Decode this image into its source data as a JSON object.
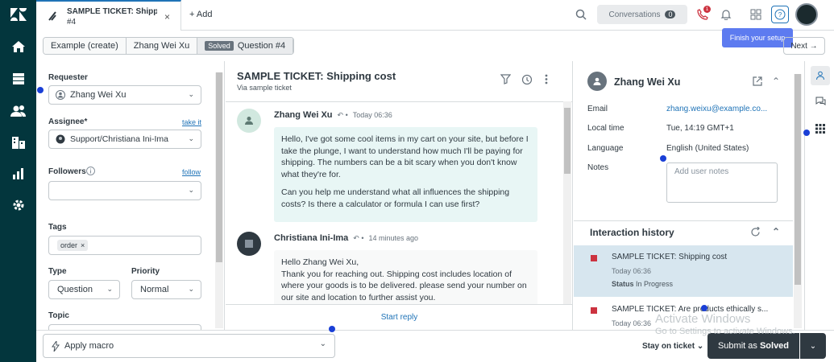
{
  "tab": {
    "title": "SAMPLE TICKET: Shipping cost",
    "number": "#4",
    "close": "×"
  },
  "header": {
    "add_label": "+ Add",
    "conversations_label": "Conversations",
    "conversations_count": "0",
    "phone_badge": "1",
    "tooltip": "Finish your setup"
  },
  "breadcrumbs": {
    "item1": "Example (create)",
    "item2": "Zhang Wei Xu",
    "status": "Solved",
    "item3": "Question #4",
    "next": "Next →"
  },
  "ticket_fields": {
    "requester_label": "Requester",
    "requester_value": "Zhang Wei Xu",
    "assignee_label": "Assignee*",
    "take_it": "take it",
    "assignee_value": "Support/Christiana Ini-Ima",
    "followers_label": "Followers",
    "follow": "follow",
    "tags_label": "Tags",
    "tag": "order",
    "type_label": "Type",
    "type_value": "Question",
    "priority_label": "Priority",
    "priority_value": "Normal",
    "topic_label": "Topic"
  },
  "conversation": {
    "title": "SAMPLE TICKET: Shipping cost",
    "subtitle": "Via sample ticket",
    "messages": [
      {
        "author": "Zhang Wei Xu",
        "time": "Today 06:36",
        "p1": "Hello, I've got some cool items in my cart on your site, but before I take the plunge, I want to understand how much I'll be paying for shipping. The numbers can be a bit scary when you don't know what they're for.",
        "p2": "Can you help me understand what all influences the shipping costs? Is there a calculator or formula I can use first?"
      },
      {
        "author": "Christiana Ini-Ima",
        "time": "14 minutes ago",
        "p1": "Hello Zhang Wei Xu,",
        "p2": "Thank you for reaching out. Shipping cost includes location of where your goods is to be delivered. please send your number on our site and location to further assist you."
      }
    ],
    "start_reply": "Start reply"
  },
  "user_panel": {
    "name": "Zhang Wei Xu",
    "email_label": "Email",
    "email": "zhang.weixu@example.co...",
    "local_time_label": "Local time",
    "local_time": "Tue, 14:19 GMT+1",
    "language_label": "Language",
    "language": "English (United States)",
    "notes_label": "Notes",
    "notes_placeholder": "Add user notes"
  },
  "interaction_history": {
    "title": "Interaction history",
    "items": [
      {
        "title": "SAMPLE TICKET: Shipping cost",
        "time": "Today 06:36",
        "status_label": "Status",
        "status": "In Progress"
      },
      {
        "title": "SAMPLE TICKET: Are products ethically s...",
        "time": "Today 06:36"
      }
    ]
  },
  "footer": {
    "apply_macro": "Apply macro",
    "stay_on_ticket": "Stay on ticket",
    "submit_prefix": "Submit as",
    "submit_status": "Solved"
  },
  "watermark": {
    "line1": "Activate Windows",
    "line2": "Go to Settings to activate Windows."
  },
  "colors": {
    "nav_bg": "#03363d",
    "accent": "#1f73b7",
    "submit_bg": "#2f3941",
    "tooltip_bg": "#5d7bf0",
    "history_active": "#d7e6ef",
    "status_red": "#cc3340"
  }
}
